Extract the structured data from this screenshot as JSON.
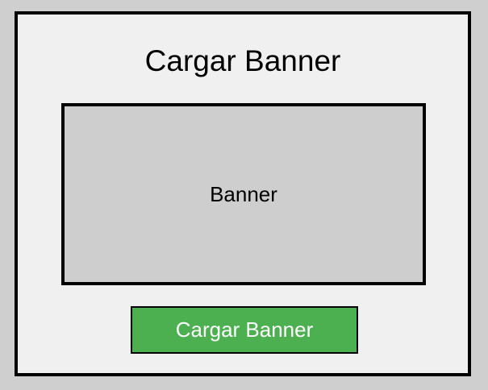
{
  "page": {
    "title": "Cargar Banner"
  },
  "banner": {
    "label": "Banner"
  },
  "actions": {
    "upload_label": "Cargar Banner"
  },
  "colors": {
    "background": "#cfcfcf",
    "panel": "#f0f0f0",
    "banner_placeholder": "#cecece",
    "button": "#4caf50",
    "button_text": "#ffffff",
    "border": "#000000"
  }
}
